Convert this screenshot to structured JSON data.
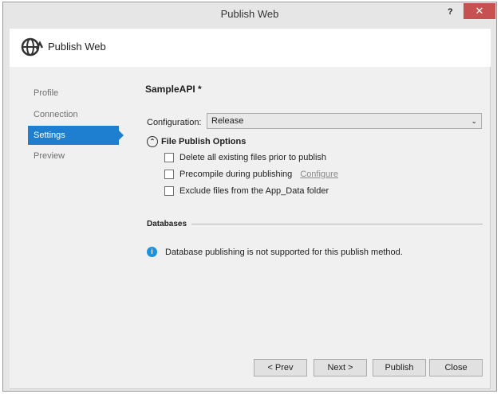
{
  "window": {
    "title": "Publish Web",
    "help": "?",
    "close": "✕"
  },
  "header": {
    "title": "Publish Web"
  },
  "nav": {
    "items": [
      {
        "label": "Profile"
      },
      {
        "label": "Connection"
      },
      {
        "label": "Settings"
      },
      {
        "label": "Preview"
      }
    ],
    "active": "Settings"
  },
  "settings": {
    "project_name": "SampleAPI *",
    "configuration_label": "Configuration:",
    "configuration_value": "Release",
    "file_publish_options": "File Publish Options",
    "options": [
      {
        "label": "Delete all existing files prior to publish",
        "checked": false
      },
      {
        "label": "Precompile during publishing",
        "checked": false,
        "link": "Configure"
      },
      {
        "label": "Exclude files from the App_Data folder",
        "checked": false
      }
    ],
    "databases_heading": "Databases",
    "databases_info": "Database publishing is not supported for this publish method."
  },
  "buttons": {
    "prev": "< Prev",
    "next": "Next >",
    "publish": "Publish",
    "close": "Close"
  }
}
